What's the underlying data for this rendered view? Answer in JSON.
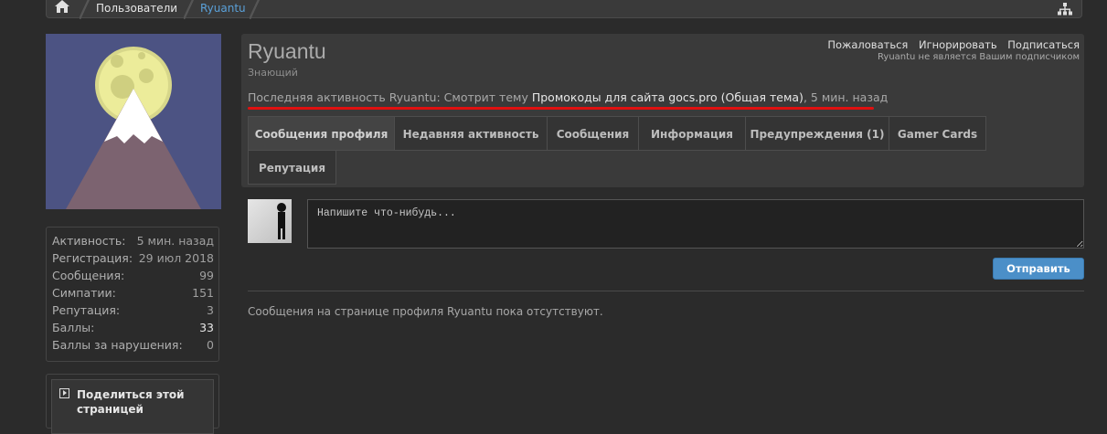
{
  "breadcrumb": {
    "items": [
      {
        "label": "Пользователи"
      },
      {
        "label": "Ryuantu"
      }
    ]
  },
  "icons": {
    "home": "home-icon",
    "sitemap": "sitemap-icon",
    "share": "play-square-icon"
  },
  "profile": {
    "username": "Ryuantu",
    "title": "Знающий",
    "links": {
      "report": "Пожаловаться",
      "ignore": "Игнорировать",
      "follow": "Подписаться"
    },
    "follow_note": "Ryuantu не является Вашим подписчиком",
    "last_activity": {
      "prefix": "Последняя активность Ryuantu:",
      "action": "Смотрит тему",
      "thread": "Промокоды для сайта gocs.pro (Общая тема)",
      "time": "5 мин. назад"
    }
  },
  "tabs": [
    {
      "label": "Сообщения профиля",
      "active": true
    },
    {
      "label": "Недавняя активность"
    },
    {
      "label": "Сообщения"
    },
    {
      "label": "Информация"
    },
    {
      "label": "Предупреждения (1)"
    },
    {
      "label": "Gamer Cards"
    },
    {
      "label": "Репутация"
    }
  ],
  "stats": [
    {
      "label": "Активность:",
      "value": "5 мин. назад"
    },
    {
      "label": "Регистрация:",
      "value": "29 июл 2018"
    },
    {
      "label": "Сообщения:",
      "value": "99"
    },
    {
      "label": "Симпатии:",
      "value": "151"
    },
    {
      "label": "Репутация:",
      "value": "3"
    },
    {
      "label": "Баллы:",
      "value": "33"
    },
    {
      "label": "Баллы за нарушения:",
      "value": "0"
    }
  ],
  "share": {
    "label": "Поделиться этой страницей"
  },
  "status_post": {
    "placeholder": "Напишите что-нибудь...",
    "submit_label": "Отправить"
  },
  "empty_note": "Сообщения на странице профиля Ryuantu пока отсутствуют.",
  "colors": {
    "accent": "#4b8fc8",
    "active_crumb": "#5aa0d8",
    "highlight_underline": "#e01010",
    "avatar_bg": "#4c5383"
  }
}
